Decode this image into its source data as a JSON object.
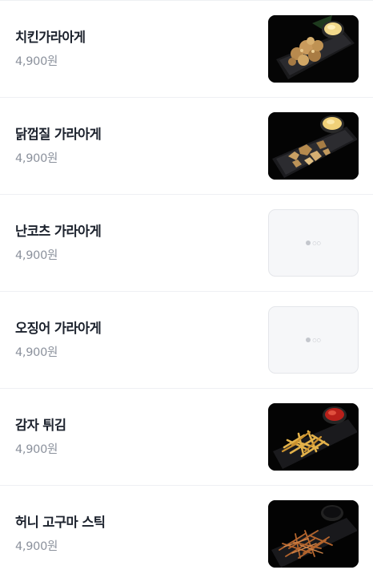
{
  "menu": {
    "items": [
      {
        "name": "치킨가라아게",
        "price": "4,900원",
        "image": "chicken-karaage-photo",
        "has_photo": true
      },
      {
        "name": "닭껍질 가라아게",
        "price": "4,900원",
        "image": "chicken-skin-karaage-photo",
        "has_photo": true
      },
      {
        "name": "난코츠 가라아게",
        "price": "4,900원",
        "image": "placeholder-logo",
        "has_photo": false
      },
      {
        "name": "오징어 가라아게",
        "price": "4,900원",
        "image": "placeholder-logo",
        "has_photo": false
      },
      {
        "name": "감자 튀김",
        "price": "4,900원",
        "image": "french-fries-photo",
        "has_photo": true
      },
      {
        "name": "허니 고구마 스틱",
        "price": "4,900원",
        "image": "sweet-potato-sticks-photo",
        "has_photo": true
      }
    ]
  },
  "colors": {
    "divider": "#eef0f3",
    "price_text": "#8b919c",
    "name_text": "#1c222d"
  }
}
